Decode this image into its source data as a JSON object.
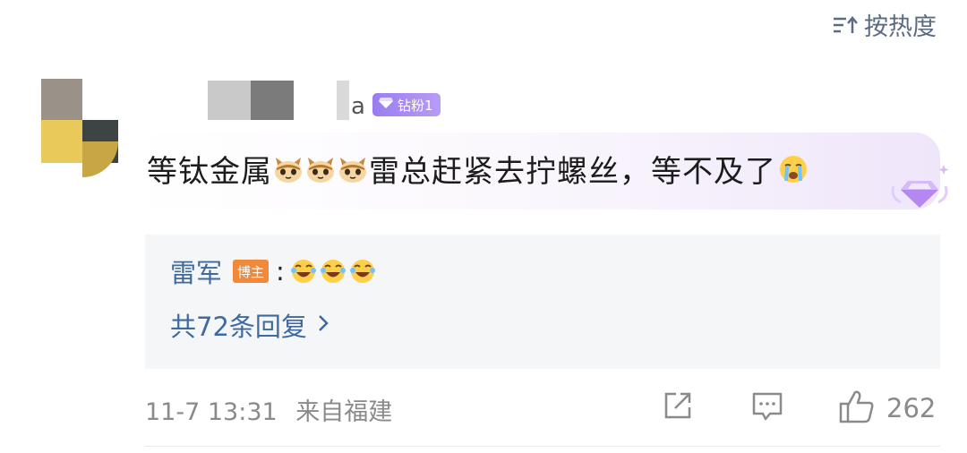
{
  "sort": {
    "label": "按热度",
    "icon": "sort-icon"
  },
  "comment": {
    "user_suffix": "a",
    "fan_badge": "钻粉1",
    "text_part1": "等钛金属",
    "text_part2": " 雷总赶紧去拧螺丝，等不及了",
    "emoji_cat_count": 3
  },
  "reply": {
    "author": "雷军",
    "host_badge": "博主",
    "colon": ":",
    "emoji_laugh_count": 3,
    "count_text": "共72条回复",
    "chevron": "›"
  },
  "footer": {
    "datetime": "11-7 13:31",
    "location": "来自福建",
    "like_count": "262"
  },
  "colors": {
    "link": "#3f6aa0",
    "muted": "#8a8a8a",
    "fan_badge": "#9b7cf0",
    "host_badge": "#f08a3a",
    "reply_bg": "#f5f6f8"
  },
  "icons": [
    "sort-icon",
    "diamond-icon",
    "cat-emoji-icon",
    "crying-emoji-icon",
    "gem-decoration-icon",
    "laughing-emoji-icon",
    "chevron-right-icon",
    "share-icon",
    "comment-icon",
    "like-icon"
  ]
}
